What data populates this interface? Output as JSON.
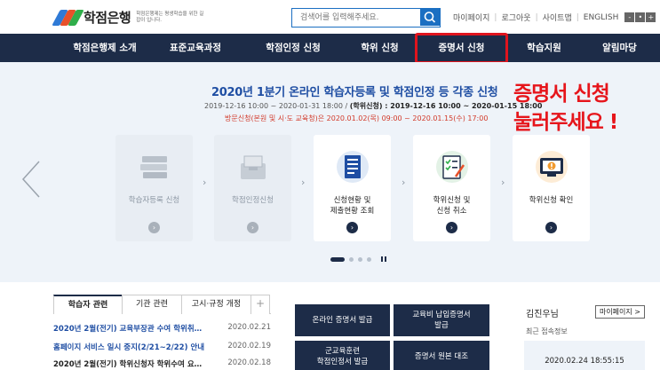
{
  "header": {
    "logo_text": "학점은행",
    "logo_sub": "학점은행제는 평생학습을 위한 길잡이 입니다.",
    "search_placeholder": "검색어를 입력해주세요.",
    "util_links": [
      "마이페이지",
      "로그아웃",
      "사이트맵",
      "ENGLISH"
    ],
    "size_buttons": [
      "-",
      "•",
      "+"
    ]
  },
  "nav": {
    "items": [
      "학점은행제 소개",
      "표준교육과정",
      "학점인정 신청",
      "학위 신청",
      "증명서 신청",
      "학습지원",
      "알림마당"
    ]
  },
  "hero": {
    "title": "2020년 1분기 온라인 학습자등록 및 학점인정 등 각종 신청",
    "line1_prefix": "2019-12-16 10:00 ~ 2020-01-31 18:00 / ",
    "line1_bold": "(학위신청) : 2019-12-16 10:00 ~ 2020-01-15 18:00",
    "line2": "방문신청(본원 및 시·도 교육청)은 2020.01.02(목) 09:00 ~ 2020.01.15(수) 17:00",
    "cards": [
      {
        "label": "학습자등록 신청",
        "active": false
      },
      {
        "label": "학점인정신청",
        "active": false
      },
      {
        "label": "신청현황 및\n제출현황 조회",
        "active": true
      },
      {
        "label": "학위신청 및\n신청 취소",
        "active": true
      },
      {
        "label": "학위신청 확인",
        "active": true
      }
    ]
  },
  "annotation": {
    "line1": "증명서 신청",
    "line2": "눌러주세요 !"
  },
  "tabs": [
    "학습자 관련",
    "기관 관련",
    "고시·규정 개정",
    "+"
  ],
  "notices": [
    {
      "title": "2020년 2월(전기) 교육부장관 수여 학위취…",
      "date": "2020.02.21"
    },
    {
      "title": "홈페이지 서비스 일시 중지(2/21~2/22) 안내",
      "date": "2020.02.19"
    },
    {
      "title": "2020년 2월(전기) 학위신청자 학위수여 요…",
      "date": "2020.02.18"
    }
  ],
  "services": [
    "온라인 증명서 발급",
    "교육비 납입증명서\n발급",
    "군교육훈련\n학점인정서 발급",
    "증명서 원본 대조"
  ],
  "login": {
    "name": "김진우님",
    "mypage": "마이페이지 >",
    "sub": "최근 접속정보",
    "time": "2020.02.24 18:55:15"
  },
  "colors": {
    "navy": "#1d2c48",
    "blue": "#1f4ea3",
    "annotation_red": "#e6151b"
  }
}
